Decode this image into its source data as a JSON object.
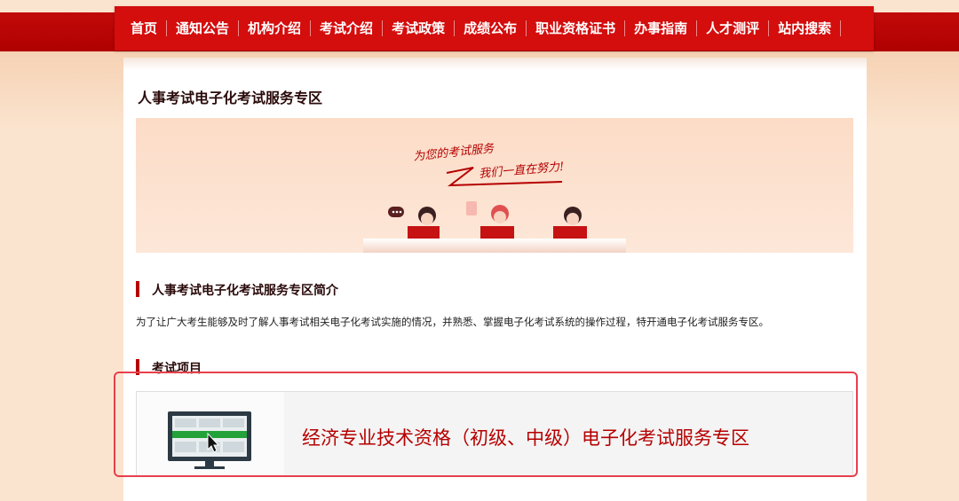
{
  "nav": {
    "items": [
      "首页",
      "通知公告",
      "机构介绍",
      "考试介绍",
      "考试政策",
      "成绩公布",
      "职业资格证书",
      "办事指南",
      "人才测评",
      "站内搜索"
    ]
  },
  "page": {
    "title": "人事考试电子化考试服务专区"
  },
  "banner": {
    "slogan_line1": "为您的考试服务",
    "slogan_line2": "我们一直在努力!"
  },
  "intro": {
    "heading": "人事考试电子化考试服务专区简介",
    "text": "为了让广大考生能够及时了解人事考试相关电子化考试实施的情况，并熟悉、掌握电子化考试系统的操作过程，特开通电子化考试服务专区。"
  },
  "exams": {
    "heading": "考试项目",
    "items": [
      {
        "label": "经济专业技术资格（初级、中级）电子化考试服务专区"
      }
    ]
  },
  "colors": {
    "brand_red": "#d40d0d",
    "dark_red": "#b50000",
    "highlight": "#e7404c",
    "background": "#fbe4cf"
  }
}
